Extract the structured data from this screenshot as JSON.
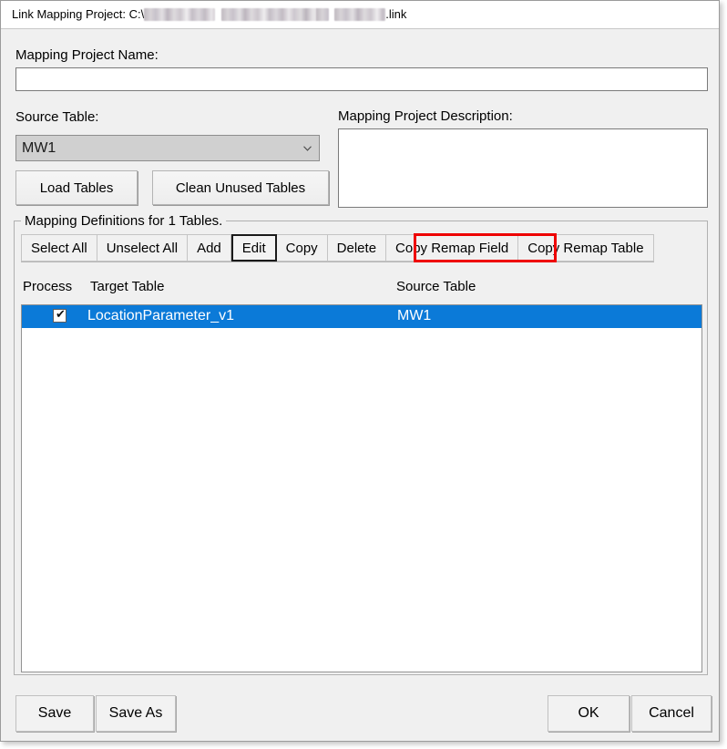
{
  "window": {
    "title_prefix": "Link Mapping Project: C:\\",
    "title_suffix": ".link",
    "path_redacted": true
  },
  "form": {
    "project_name_label": "Mapping Project Name:",
    "project_name_value": "",
    "project_name_placeholder": "",
    "source_table_label": "Source Table:",
    "source_table_value": "MW1",
    "description_label": "Mapping Project Description:",
    "description_value": "",
    "description_placeholder": "",
    "load_tables_label": "Load Tables",
    "clean_unused_tables_label": "Clean Unused Tables"
  },
  "mapping_group": {
    "legend": "Mapping Definitions for 1 Tables.",
    "toolbar": [
      {
        "id": "select-all",
        "label": "Select All",
        "state": "normal"
      },
      {
        "id": "unselect-all",
        "label": "Unselect All",
        "state": "normal"
      },
      {
        "id": "add",
        "label": "Add",
        "state": "normal"
      },
      {
        "id": "edit",
        "label": "Edit",
        "state": "focused"
      },
      {
        "id": "copy",
        "label": "Copy",
        "state": "normal"
      },
      {
        "id": "delete",
        "label": "Delete",
        "state": "normal"
      },
      {
        "id": "copy-remap-field",
        "label": "Copy Remap Field",
        "state": "annotated"
      },
      {
        "id": "copy-remap-table",
        "label": "Copy Remap Table",
        "state": "normal"
      }
    ],
    "annotation_color": "#ee0000",
    "columns": {
      "process": "Process",
      "target_table": "Target Table",
      "source_table": "Source Table"
    },
    "rows": [
      {
        "process_checked": true,
        "check_glyph": "✔",
        "target_table": "LocationParameter_v1",
        "source_table": "MW1",
        "selected": true
      }
    ]
  },
  "footer": {
    "save_label": "Save",
    "save_as_label": "Save As",
    "ok_label": "OK",
    "cancel_label": "Cancel"
  },
  "colors": {
    "selection_blue": "#0b7ad8",
    "annotation_red": "#ee0000",
    "dialog_face": "#f0f0f0"
  }
}
